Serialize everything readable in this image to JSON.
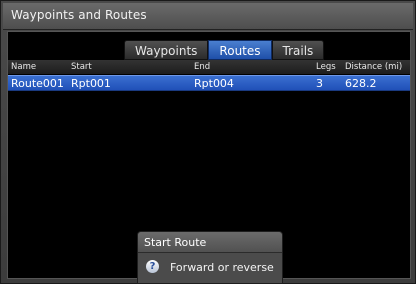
{
  "window": {
    "title": "Waypoints and Routes"
  },
  "tabs": [
    "Waypoints",
    "Routes",
    "Trails"
  ],
  "active_tab": "Routes",
  "table": {
    "columns": [
      "Name",
      "Start",
      "End",
      "Legs",
      "Distance (mi)"
    ],
    "rows": [
      {
        "name": "Route001",
        "start": "Rpt001",
        "end": "Rpt004",
        "legs": "3",
        "distance": "628.2"
      }
    ]
  },
  "popup": {
    "title": "Start Route",
    "items": [
      {
        "label": "Forward or reverse",
        "icon": "help-icon"
      }
    ]
  },
  "colors": {
    "accent": "#2a5cc0",
    "background": "#000000"
  }
}
